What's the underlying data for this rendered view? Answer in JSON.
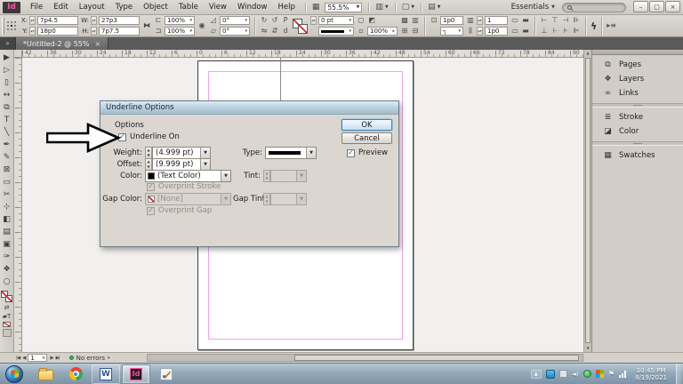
{
  "colors": {
    "logo_pink": "#ff4fa3",
    "margin_guide": "#efa3ef",
    "preflight_green": "#3cb44a",
    "taskbar_top": "#b9c9d5",
    "taskbar_bottom": "#7e94a6",
    "dialog_title_top": "#dcebf4",
    "dialog_title_bottom": "#a3bccd"
  },
  "app": {
    "logo": "Id",
    "menus": [
      "File",
      "Edit",
      "Layout",
      "Type",
      "Object",
      "Table",
      "View",
      "Window",
      "Help"
    ],
    "zoom_value": "55.5%",
    "workspace": "Essentials",
    "win": {
      "minimize": "–",
      "restore": "▢",
      "close": "×"
    }
  },
  "control_panel": {
    "x_label": "X:",
    "x": "7p4.5",
    "y_label": "Y:",
    "y": "18p0",
    "w_label": "W:",
    "w": "27p3",
    "h_label": "H:",
    "h": "7p7.5",
    "scale_x": "100%",
    "scale_y": "100%",
    "rotation": "0°",
    "shear": "0°",
    "stroke_weight": "0 pt",
    "opacity": "100%",
    "corner_radius": "1p0",
    "columns": "1",
    "gutter": "1p0"
  },
  "doc_tab": {
    "title": "*Untitled-2 @ 55%",
    "close": "×"
  },
  "tools": [
    {
      "name": "selection-tool",
      "glyph": "▶"
    },
    {
      "name": "direct-selection-tool",
      "glyph": "▷"
    },
    {
      "name": "page-tool",
      "glyph": "▯"
    },
    {
      "name": "gap-tool",
      "glyph": "↔"
    },
    {
      "name": "content-collector-tool",
      "glyph": "⧉"
    },
    {
      "name": "type-tool",
      "glyph": "T"
    },
    {
      "name": "line-tool",
      "glyph": "╲"
    },
    {
      "name": "pen-tool",
      "glyph": "✒"
    },
    {
      "name": "pencil-tool",
      "glyph": "✎"
    },
    {
      "name": "rectangle-frame-tool",
      "glyph": "⊠"
    },
    {
      "name": "rectangle-tool",
      "glyph": "▭"
    },
    {
      "name": "scissors-tool",
      "glyph": "✂"
    },
    {
      "name": "free-transform-tool",
      "glyph": "⊹"
    },
    {
      "name": "gradient-swatch-tool",
      "glyph": "◧"
    },
    {
      "name": "gradient-feather-tool",
      "glyph": "▤"
    },
    {
      "name": "note-tool",
      "glyph": "▣"
    },
    {
      "name": "eyedropper-tool",
      "glyph": "✑"
    },
    {
      "name": "hand-tool",
      "glyph": "❖"
    },
    {
      "name": "zoom-tool",
      "glyph": "○"
    }
  ],
  "rulers": {
    "horizontal": [
      "42",
      "36",
      "30",
      "24",
      "18",
      "12",
      "6",
      "0",
      "6",
      "12",
      "18",
      "24",
      "30",
      "36",
      "42",
      "48",
      "54",
      "60",
      "66",
      "72",
      "78",
      "84",
      "90"
    ]
  },
  "dialog": {
    "title": "Underline Options",
    "section_label": "Options",
    "underline_on_label": "Underline On",
    "weight_label": "Weight:",
    "weight_value": "(4.999 pt)",
    "type_label": "Type:",
    "offset_label": "Offset:",
    "offset_value": "(9.999 pt)",
    "color_label": "Color:",
    "color_value": "(Text Color)",
    "tint_label": "Tint:",
    "overprint_stroke_label": "Overprint Stroke",
    "gap_color_label": "Gap Color:",
    "gap_color_value": "[None]",
    "gap_tint_label": "Gap Tint:",
    "overprint_gap_label": "Overprint Gap",
    "ok_label": "OK",
    "cancel_label": "Cancel",
    "preview_label": "Preview"
  },
  "dock": {
    "group1": [
      {
        "label": "Pages",
        "icon": "pages-icon",
        "glyph": "⧉"
      },
      {
        "label": "Layers",
        "icon": "layers-icon",
        "glyph": "❖"
      },
      {
        "label": "Links",
        "icon": "links-icon",
        "glyph": "∞"
      }
    ],
    "group2": [
      {
        "label": "Stroke",
        "icon": "stroke-icon",
        "glyph": "≣"
      },
      {
        "label": "Color",
        "icon": "color-icon",
        "glyph": "◪"
      }
    ],
    "group3": [
      {
        "label": "Swatches",
        "icon": "swatches-icon",
        "glyph": "▦"
      }
    ]
  },
  "status": {
    "page": "1",
    "preflight": "No errors"
  },
  "taskbar": {
    "word_glyph": "W",
    "indesign_glyph": "Id",
    "time": "10:45 PM",
    "date": "8/19/2021"
  }
}
